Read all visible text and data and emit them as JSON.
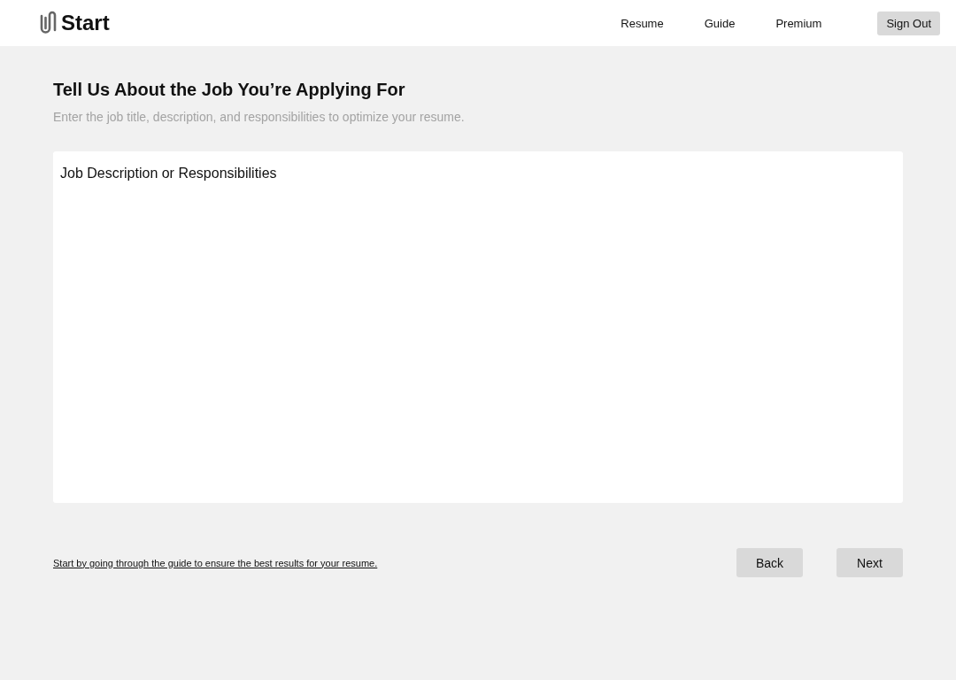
{
  "header": {
    "logo": "Start",
    "nav": [
      "Resume",
      "Guide",
      "Premium"
    ],
    "sign_out": "Sign Out"
  },
  "heading": "Tell Us About the Job You’re Applying For",
  "subheading": "Enter the job title, description, and responsibilities to optimize your resume.",
  "job_field": {
    "placeholder": "Job Description or Responsibilities"
  },
  "footer": {
    "guide_link": "Start by going through the guide to ensure the best results for your resume.",
    "buttons": [
      "Back",
      "Next"
    ]
  }
}
